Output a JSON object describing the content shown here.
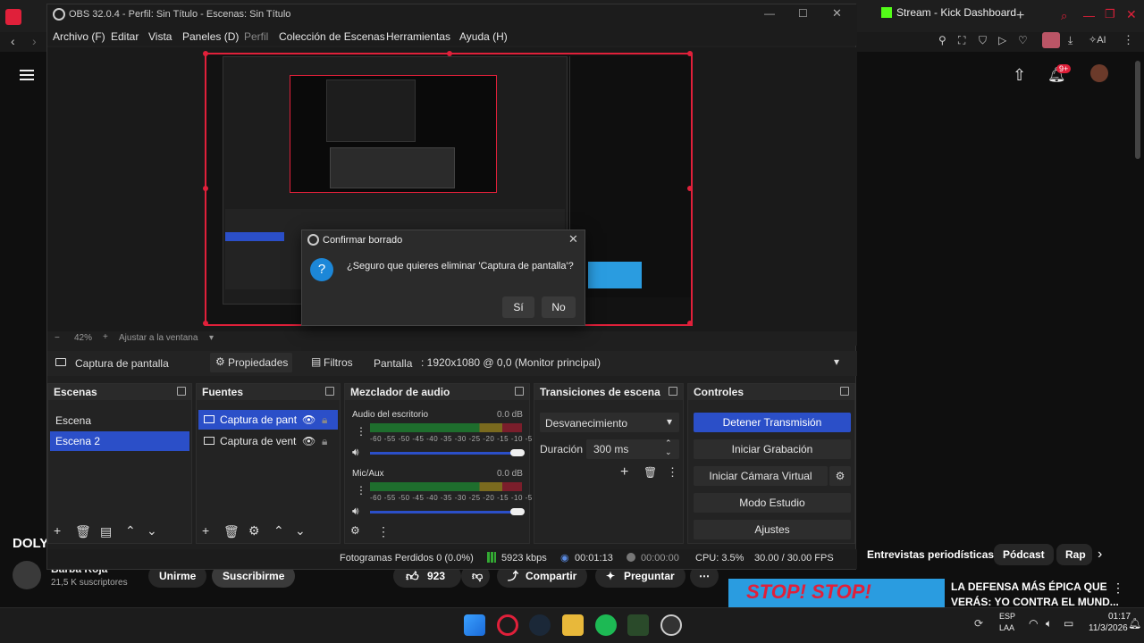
{
  "browser": {
    "tab_title": "Stream - Kick Dashboard",
    "notif_badge": "9+",
    "channel_partial": "DOLY",
    "channel_name": "Barba Roja",
    "subscribers": "21,5 K suscriptores",
    "unjoin_label": "Unirme",
    "subscribe_label": "Suscribirme",
    "likes": "923",
    "share_label": "Compartir",
    "ask_label": "Preguntar",
    "chips": [
      "Entrevistas periodísticas",
      "Pódcast",
      "Rap"
    ],
    "rec_title_1": "LA DEFENSA MÁS ÉPICA QUE",
    "rec_title_2": "VERÁS: YO CONTRA EL MUND...",
    "thumb_text": "STOP! STOP!"
  },
  "obs": {
    "title": "OBS 32.0.4 - Perfil: Sin Título - Escenas: Sin Título",
    "menu": [
      "Archivo (F)",
      "Editar",
      "Vista",
      "Paneles (D)",
      "Perfil",
      "Colección de Escenas",
      "Herramientas",
      "Ayuda (H)"
    ],
    "zoom": "42%",
    "fit_label": "Ajustar a la ventana",
    "source_selected": "Captura de pantalla",
    "properties_label": "Propiedades",
    "filters_label": "Filtros",
    "display_label": "Pantalla",
    "display_value": ": 1920x1080 @ 0,0 (Monitor principal)",
    "docks": {
      "scenes": {
        "title": "Escenas",
        "items": [
          "Escena",
          "Escena 2"
        ]
      },
      "sources": {
        "title": "Fuentes",
        "items": [
          "Captura de panta",
          "Captura de venta"
        ]
      },
      "mixer": {
        "title": "Mezclador de audio",
        "channels": [
          {
            "name": "Audio del escritorio",
            "db": "0.0 dB"
          },
          {
            "name": "Mic/Aux",
            "db": "0.0 dB"
          }
        ],
        "ticks": "-60 -55 -50 -45 -40 -35 -30 -25 -20 -15 -10 -5 0"
      },
      "transitions": {
        "title": "Transiciones de escena",
        "transition": "Desvanecimiento",
        "duration_label": "Duración",
        "duration_value": "300 ms"
      },
      "controls": {
        "title": "Controles",
        "buttons": [
          "Detener Transmisión",
          "Iniciar Grabación",
          "Iniciar Cámara Virtual",
          "Modo Estudio",
          "Ajustes"
        ]
      }
    },
    "status": {
      "dropped": "Fotogramas Perdidos 0 (0.0%)",
      "bitrate": "5923 kbps",
      "stream_time": "00:01:13",
      "rec_time": "00:00:00",
      "cpu": "CPU: 3.5%",
      "fps": "30.00 / 30.00 FPS"
    }
  },
  "dialog": {
    "title": "Confirmar borrado",
    "message": "¿Seguro que quieres eliminar 'Captura de pantalla'?",
    "yes": "Sí",
    "no": "No"
  },
  "taskbar": {
    "lang": "ESP",
    "region": "LAA",
    "time": "01:17",
    "date": "11/3/2026"
  },
  "colors": {
    "accent": "#2b4fc8",
    "selection_border": "#e0203a",
    "kick_green": "#53fc18"
  }
}
